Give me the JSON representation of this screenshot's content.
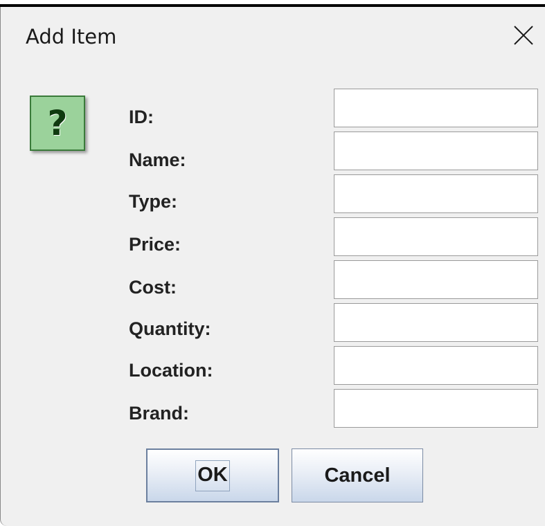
{
  "window": {
    "title": "Add Item",
    "close_icon": "close-icon"
  },
  "icon": {
    "name": "question-icon",
    "glyph": "?",
    "color": "#9bd29b"
  },
  "form": {
    "fields": [
      {
        "label": "ID:",
        "value": ""
      },
      {
        "label": "Name:",
        "value": ""
      },
      {
        "label": "Type:",
        "value": ""
      },
      {
        "label": "Price:",
        "value": ""
      },
      {
        "label": "Cost:",
        "value": ""
      },
      {
        "label": "Quantity:",
        "value": ""
      },
      {
        "label": "Location:",
        "value": ""
      },
      {
        "label": "Brand:",
        "value": ""
      }
    ]
  },
  "buttons": {
    "ok_label": "OK",
    "cancel_label": "Cancel"
  }
}
